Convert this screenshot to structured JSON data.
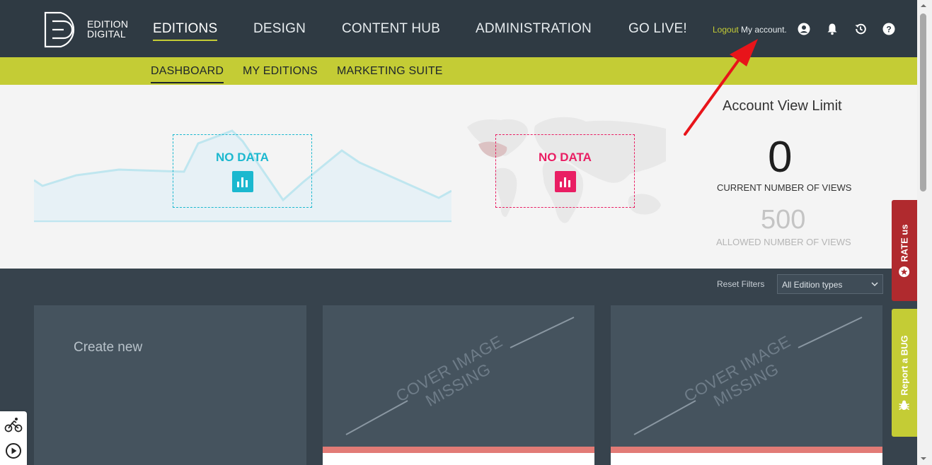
{
  "brand": {
    "line1": "EDITION",
    "line2": "DIGITAL"
  },
  "nav": {
    "items": [
      {
        "label": "EDITIONS",
        "active": true
      },
      {
        "label": "DESIGN"
      },
      {
        "label": "CONTENT HUB"
      },
      {
        "label": "ADMINISTRATION"
      },
      {
        "label": "GO LIVE!"
      }
    ],
    "logout": "Logout",
    "my_account": "My account.",
    "icons": [
      "user-circle-icon",
      "bell-icon",
      "history-icon",
      "help-icon"
    ]
  },
  "subnav": {
    "items": [
      {
        "label": "DASHBOARD",
        "active": true
      },
      {
        "label": "MY EDITIONS"
      },
      {
        "label": "MARKETING SUITE"
      }
    ]
  },
  "stats": {
    "chart_no_data": "NO DATA",
    "map_no_data": "NO DATA",
    "limit_title": "Account View Limit",
    "current_views": "0",
    "current_views_label": "CURRENT NUMBER OF VIEWS",
    "allowed_views": "500",
    "allowed_views_label": "ALLOWED NUMBER OF VIEWS"
  },
  "filters": {
    "reset": "Reset Filters",
    "edition_type": "All Edition types"
  },
  "cards": {
    "create_new": "Create new",
    "cover_missing": "COVER IMAGE MISSING"
  },
  "side_tabs": {
    "rate": "RATE us",
    "bug": "Report a BUG"
  },
  "colors": {
    "topbar": "#2f3a43",
    "accent": "#c4cc35",
    "teal": "#1bb8cf",
    "pink": "#e91e63",
    "rate_red": "#b02a2e",
    "annotation": "#e8141a"
  }
}
